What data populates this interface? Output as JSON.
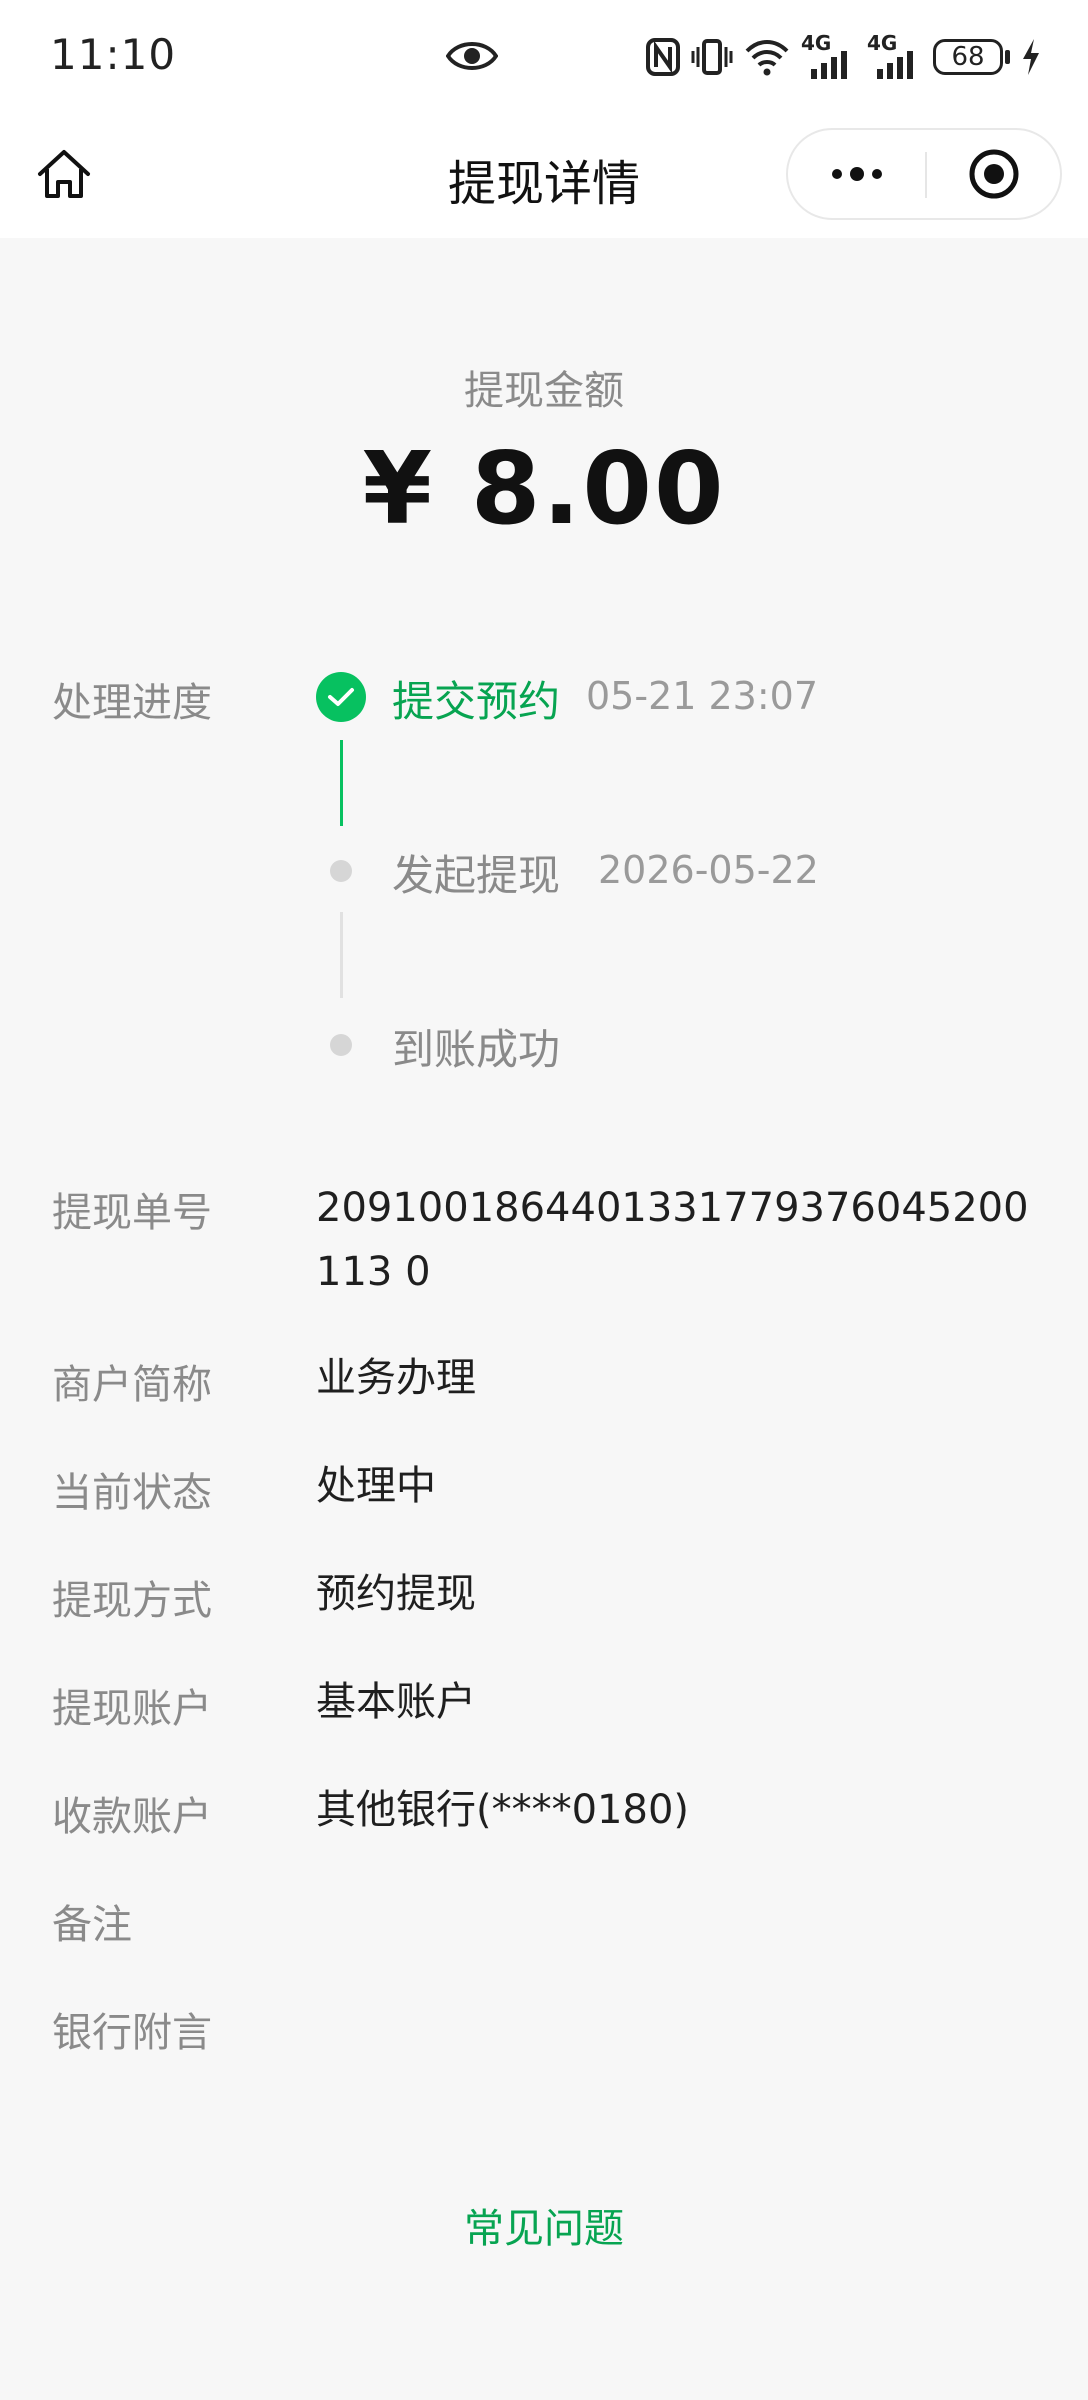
{
  "status_bar": {
    "time": "11:10",
    "network_label_1": "4G",
    "network_label_2": "4G",
    "battery": "68"
  },
  "nav": {
    "title": "提现详情"
  },
  "amount": {
    "label": "提现金额",
    "value": "¥ 8.00"
  },
  "progress": {
    "label": "处理进度",
    "steps": [
      {
        "name": "提交预约",
        "time": "05-21 23:07",
        "done": true
      },
      {
        "name": "发起提现",
        "time": "2026-05-22",
        "done": false
      },
      {
        "name": "到账成功",
        "time": "",
        "done": false
      }
    ]
  },
  "details": [
    {
      "label": "提现单号",
      "value": "2091001864401331779376045200113 0"
    },
    {
      "label": "商户简称",
      "value": "业务办理"
    },
    {
      "label": "当前状态",
      "value": "处理中"
    },
    {
      "label": "提现方式",
      "value": "预约提现"
    },
    {
      "label": "提现账户",
      "value": "基本账户"
    },
    {
      "label": "收款账户",
      "value": "其他银行(****0180)"
    },
    {
      "label": "备注",
      "value": ""
    },
    {
      "label": "银行附言",
      "value": ""
    }
  ],
  "faq": {
    "label": "常见问题"
  },
  "colors": {
    "accent": "#07c160",
    "link": "#07a451",
    "background": "#f7f7f7"
  },
  "icons": [
    "eye-icon",
    "nfc-icon",
    "vibrate-icon",
    "wifi-icon",
    "signal-icon",
    "battery-icon",
    "charging-icon",
    "home-icon",
    "more-icon",
    "close-miniprogram-icon",
    "check-icon"
  ]
}
